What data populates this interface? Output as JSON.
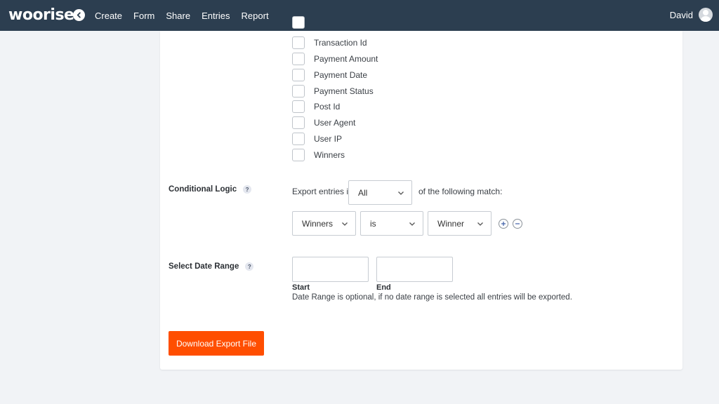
{
  "header": {
    "logo": "woorise",
    "nav": [
      "Create",
      "Form",
      "Share",
      "Entries",
      "Report"
    ],
    "user_name": "David",
    "colors": {
      "bar": "#2c3e50",
      "text": "#ffffff"
    }
  },
  "fields": {
    "checkboxes": [
      "",
      "Transaction Id",
      "Payment Amount",
      "Payment Date",
      "Payment Status",
      "Post Id",
      "User Agent",
      "User IP",
      "Winners"
    ]
  },
  "conditional": {
    "label": "Conditional Logic",
    "help": "?",
    "prefix": "Export entries if",
    "match_value": "All",
    "suffix": "of the following match:",
    "rule": {
      "field": "Winners",
      "operator": "is",
      "value": "Winner"
    }
  },
  "date_range": {
    "label": "Select Date Range",
    "help": "?",
    "start_label": "Start",
    "end_label": "End",
    "note": "Date Range is optional, if no date range is selected all entries will be exported."
  },
  "actions": {
    "download_label": "Download Export File",
    "accent": "#ff4e00"
  }
}
